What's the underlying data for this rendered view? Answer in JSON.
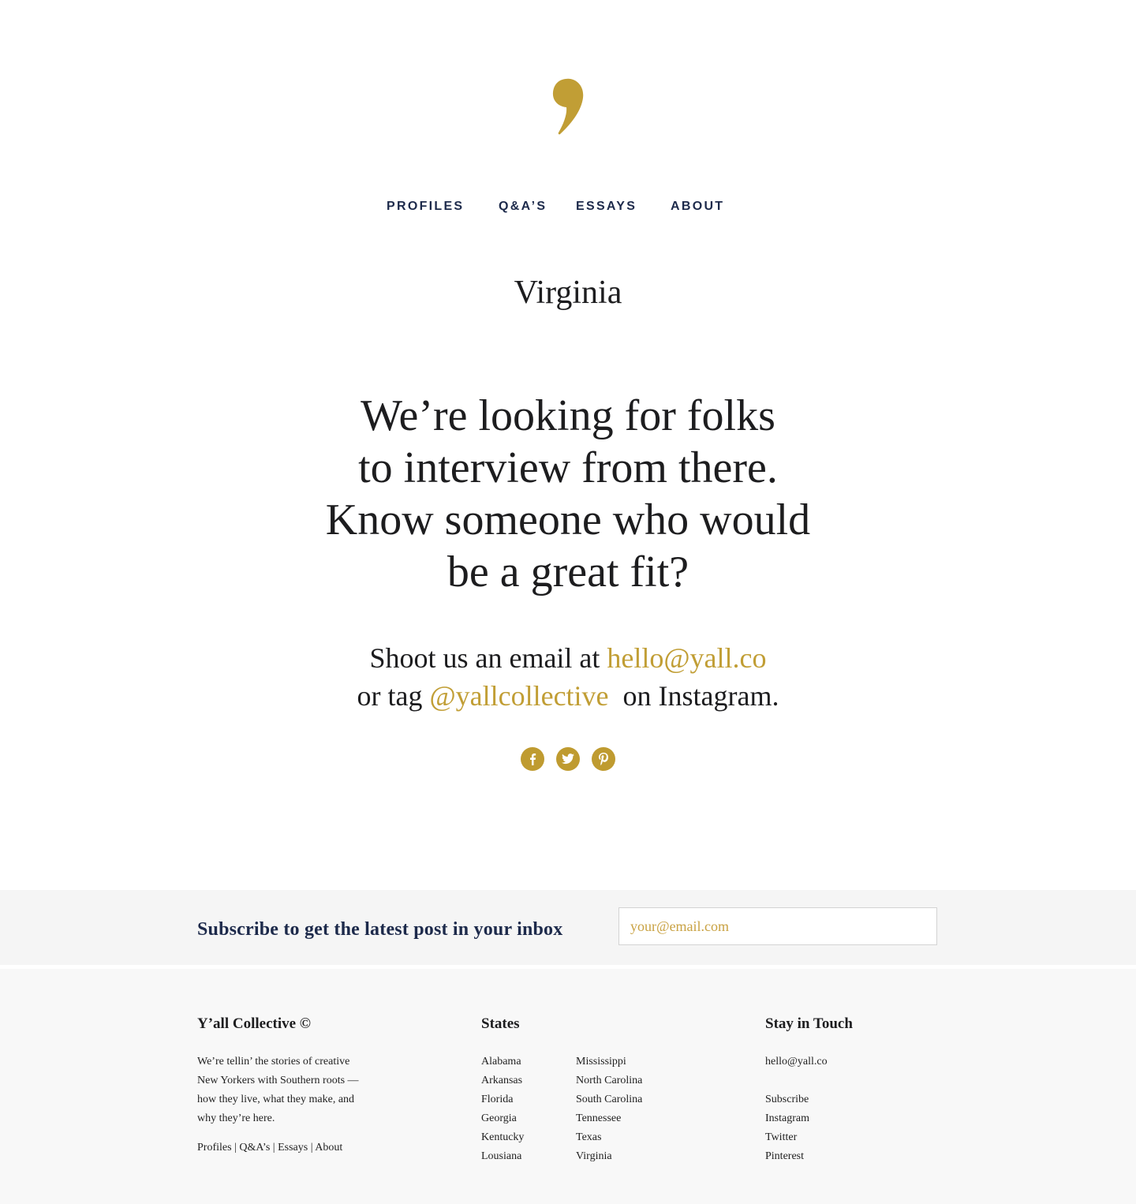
{
  "brand": {
    "logo_icon": "comma-logo-icon",
    "accent_color": "#c19e35",
    "navy_color": "#1d2a4b"
  },
  "nav": {
    "items": [
      {
        "label": "PROFILES"
      },
      {
        "label": "Q&A’S"
      },
      {
        "label": "ESSAYS"
      },
      {
        "label": "ABOUT"
      }
    ]
  },
  "page": {
    "title": "Virginia",
    "headline_lines": [
      "We’re looking for folks",
      "to interview from there.",
      "Know someone who would",
      "be a great fit?"
    ],
    "cta": {
      "line1_prefix": "Shoot us an email at ",
      "email": "hello@yall.co",
      "line2_prefix": "or tag ",
      "handle": "@yallcollective",
      "line2_suffix": "on Instagram."
    },
    "social": [
      {
        "icon": "facebook-icon",
        "glyph": "f"
      },
      {
        "icon": "twitter-icon",
        "glyph": "t"
      },
      {
        "icon": "pinterest-icon",
        "glyph": "p"
      }
    ]
  },
  "subscribe": {
    "text": "Subscribe to get the latest post in your inbox",
    "placeholder": "your@email.com"
  },
  "footer": {
    "about": {
      "heading": "Y’all Collective ©",
      "description_lines": [
        "We’re tellin’ the stories of creative",
        "New Yorkers with Southern roots —",
        "how they live, what they make, and",
        "why they’re here."
      ],
      "links": [
        "Profiles",
        "Q&A’s",
        "Essays",
        "About"
      ],
      "separator": " | "
    },
    "states": {
      "heading": "States",
      "col1": [
        "Alabama",
        "Arkansas",
        "Florida",
        "Georgia",
        "Kentucky",
        "Lousiana"
      ],
      "col2": [
        "Mississippi",
        "North Carolina",
        "South Carolina",
        "Tennessee",
        "Texas",
        "Virginia"
      ]
    },
    "contact": {
      "heading": "Stay in Touch",
      "email": "hello@yall.co",
      "links": [
        "Subscribe",
        "Instagram",
        "Twitter",
        "Pinterest"
      ]
    }
  }
}
